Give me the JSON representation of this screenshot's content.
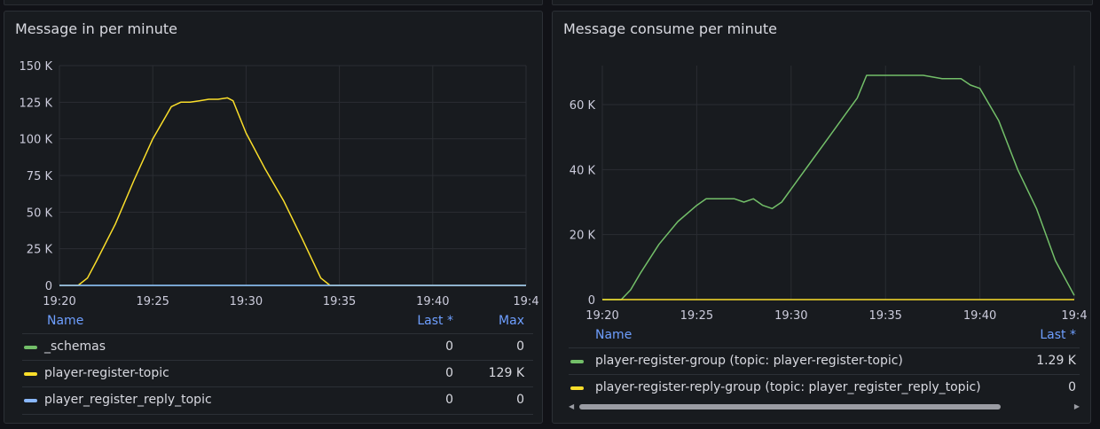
{
  "panels": [
    {
      "title": "Message in per minute",
      "legend": {
        "headers": {
          "name": "Name",
          "last": "Last *",
          "max": "Max"
        },
        "rows": [
          {
            "name": "_schemas",
            "last": "0",
            "max": "0",
            "color": "#73bf69"
          },
          {
            "name": "player-register-topic",
            "last": "0",
            "max": "129 K",
            "color": "#fade2a"
          },
          {
            "name": "player_register_reply_topic",
            "last": "0",
            "max": "0",
            "color": "#8ab8ff"
          }
        ]
      }
    },
    {
      "title": "Message consume per minute",
      "legend": {
        "headers": {
          "name": "Name",
          "last": "Last *"
        },
        "rows": [
          {
            "name": "player-register-group (topic: player-register-topic)",
            "last": "1.29 K",
            "color": "#73bf69"
          },
          {
            "name": "player-register-reply-group (topic: player_register_reply_topic)",
            "last": "0",
            "color": "#fade2a"
          }
        ]
      },
      "scrollbar": {
        "left_arrow": "◀",
        "right_arrow": "▶",
        "thumb_fraction": 0.86
      }
    }
  ],
  "chart_data": [
    {
      "type": "line",
      "title": "Message in per minute",
      "x_ticks": [
        "19:20",
        "19:25",
        "19:30",
        "19:35",
        "19:40",
        "19:4"
      ],
      "y_ticks": [
        "0",
        "25 K",
        "50 K",
        "75 K",
        "100 K",
        "125 K",
        "150 K"
      ],
      "xlim": [
        0,
        25
      ],
      "ylim": [
        0,
        150000
      ],
      "grid": true,
      "series": [
        {
          "name": "_schemas",
          "color": "#73bf69",
          "x": [
            0,
            25
          ],
          "y": [
            0,
            0
          ]
        },
        {
          "name": "player-register-topic",
          "color": "#fade2a",
          "x": [
            0,
            1,
            1.5,
            2,
            3,
            4,
            5,
            6,
            6.5,
            7,
            7.5,
            8,
            8.5,
            9,
            9.3,
            10,
            11,
            12,
            13,
            14,
            14.5,
            15,
            20,
            25
          ],
          "y": [
            0,
            0,
            5000,
            17000,
            42000,
            72000,
            100000,
            122000,
            125000,
            125000,
            126000,
            127000,
            127000,
            128000,
            126000,
            104000,
            80000,
            58000,
            32000,
            5000,
            0,
            0,
            0,
            0
          ]
        },
        {
          "name": "player_register_reply_topic",
          "color": "#8ab8ff",
          "x": [
            0,
            25
          ],
          "y": [
            0,
            0
          ]
        }
      ]
    },
    {
      "type": "line",
      "title": "Message consume per minute",
      "x_ticks": [
        "19:20",
        "19:25",
        "19:30",
        "19:35",
        "19:40",
        "19:4"
      ],
      "y_ticks": [
        "0",
        "20 K",
        "40 K",
        "60 K"
      ],
      "xlim": [
        0,
        25
      ],
      "ylim": [
        0,
        72000
      ],
      "grid": true,
      "series": [
        {
          "name": "player-register-group (topic: player-register-topic)",
          "color": "#73bf69",
          "x": [
            0,
            1,
            1.5,
            2,
            3,
            4,
            5,
            5.5,
            6,
            7,
            7.5,
            8,
            8.5,
            9,
            9.5,
            10,
            10.5,
            11,
            12,
            13,
            13.5,
            14,
            15,
            16,
            17,
            18,
            19,
            19.5,
            20,
            21,
            22,
            23,
            24,
            25
          ],
          "y": [
            0,
            0,
            3000,
            8000,
            17000,
            24000,
            29000,
            31000,
            31000,
            31000,
            30000,
            31000,
            29000,
            28000,
            30000,
            34000,
            38000,
            42000,
            50000,
            58000,
            62000,
            69000,
            69000,
            69000,
            69000,
            68000,
            68000,
            66000,
            65000,
            55000,
            40000,
            28000,
            12000,
            1290
          ]
        },
        {
          "name": "player-register-reply-group (topic: player_register_reply_topic)",
          "color": "#fade2a",
          "x": [
            0,
            25
          ],
          "y": [
            0,
            0
          ]
        }
      ]
    }
  ]
}
